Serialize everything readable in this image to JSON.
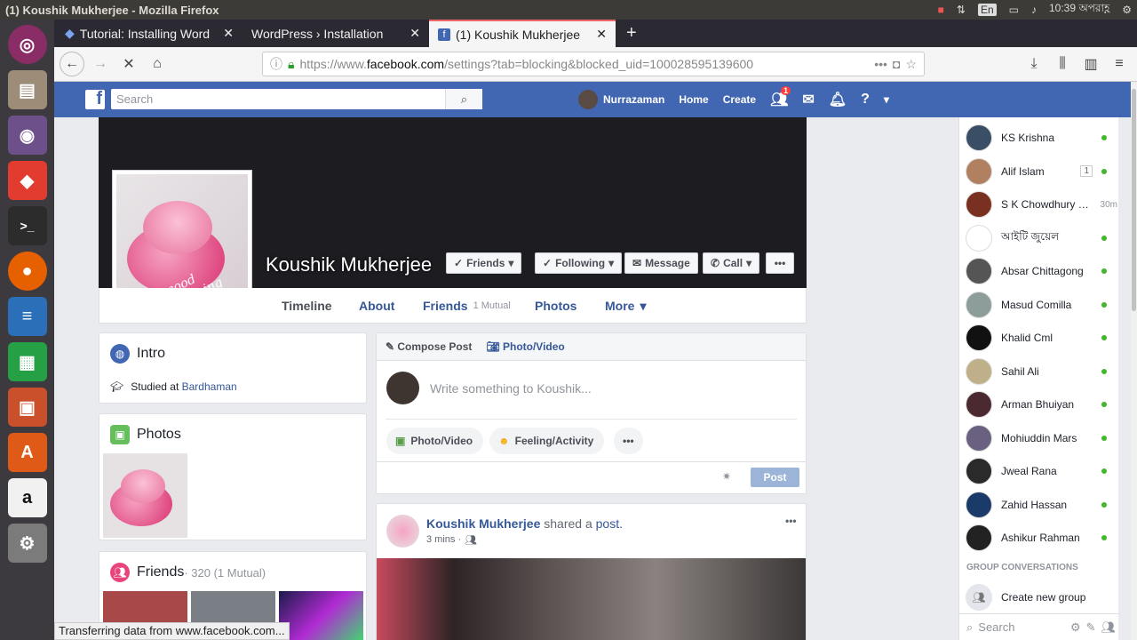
{
  "window": {
    "title": "(1) Koushik Mukherjee - Mozilla Firefox"
  },
  "system": {
    "keyboard": "En",
    "time": "10:39 অপরাহ্ণ"
  },
  "browser": {
    "tabs": [
      {
        "label": "Tutorial: Installing Word"
      },
      {
        "label": "WordPress › Installation"
      },
      {
        "label": "(1) Koushik Mukherjee"
      }
    ],
    "url_prefix": "https://www.",
    "url_domain": "facebook.com",
    "url_path": "/settings?tab=blocking&blocked_uid=100028595139600",
    "status": "Transferring data from www.facebook.com..."
  },
  "fb": {
    "search_placeholder": "Search",
    "user_name": "Nurrazaman",
    "nav_home": "Home",
    "nav_create": "Create",
    "friend_badge": "1"
  },
  "profile": {
    "name": "Koushik Mukherjee",
    "buttons": {
      "friends": "Friends",
      "following": "Following",
      "message": "Message",
      "call": "Call"
    },
    "tabs": {
      "timeline": "Timeline",
      "about": "About",
      "friends": "Friends",
      "friends_mutual": "1 Mutual",
      "photos": "Photos",
      "more": "More"
    },
    "photo_caption": "good Morning"
  },
  "intro": {
    "title": "Intro",
    "studied_prefix": "Studied at",
    "studied_place": "Bardhaman"
  },
  "photos": {
    "title": "Photos"
  },
  "friends_card": {
    "title": "Friends",
    "count": "· 320 (1 Mutual)"
  },
  "composer": {
    "compose": "Compose Post",
    "photo_video_tab": "Photo/Video",
    "placeholder": "Write something to Koushik...",
    "photo_video": "Photo/Video",
    "feeling": "Feeling/Activity",
    "post": "Post"
  },
  "feed_post": {
    "author": "Koushik Mukherjee",
    "action": "shared a",
    "object": "post.",
    "time": "3 mins ·"
  },
  "chat": {
    "contacts": [
      {
        "name": "KS Krishna",
        "status": "online"
      },
      {
        "name": "Alif Islam",
        "badge": "1",
        "status": "online"
      },
      {
        "name": "S K Chowdhury Ma...",
        "time": "30m"
      },
      {
        "name": "আইটি জুয়েল",
        "status": "online"
      },
      {
        "name": "Absar Chittagong",
        "status": "online"
      },
      {
        "name": "Masud Comilla",
        "status": "online"
      },
      {
        "name": "Khalid Cml",
        "status": "online"
      },
      {
        "name": "Sahil Ali",
        "status": "online"
      },
      {
        "name": "Arman Bhuiyan",
        "status": "online"
      },
      {
        "name": "Mohiuddin Mars",
        "status": "online"
      },
      {
        "name": "Jweal Rana",
        "status": "online"
      },
      {
        "name": "Zahid Hassan",
        "status": "online"
      },
      {
        "name": "Ashikur Rahman",
        "status": "online"
      }
    ],
    "group_header": "GROUP CONVERSATIONS",
    "create_group": "Create new group",
    "search_placeholder": "Search"
  },
  "colors": {
    "fb_blue": "#4267b2",
    "link": "#365899",
    "online": "#42b72a"
  }
}
